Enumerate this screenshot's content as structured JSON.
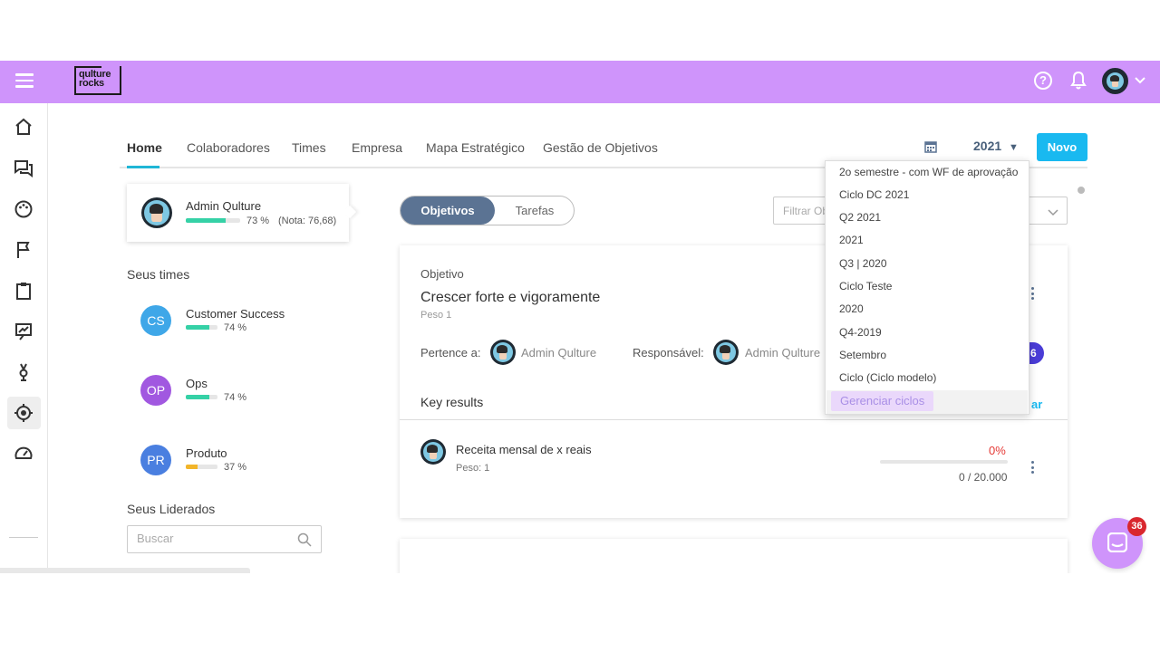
{
  "header": {
    "logo_line1": "qulture",
    "logo_line2": "rocks",
    "help_symbol": "?"
  },
  "sidebar": {
    "icons": [
      "home-icon",
      "chat-icon",
      "palette-icon",
      "flag-icon",
      "clipboard-icon",
      "presentation-icon",
      "award-icon",
      "target-icon",
      "speedometer-icon",
      "building-icon"
    ],
    "active": "target-icon"
  },
  "nav": {
    "tabs": [
      {
        "label": "Home"
      },
      {
        "label": "Colaboradores"
      },
      {
        "label": "Times"
      },
      {
        "label": "Empresa"
      },
      {
        "label": "Mapa Estratégico"
      },
      {
        "label": "Gestão de Objetivos"
      }
    ],
    "year": "2021",
    "year_arrow": "▼",
    "new_button": "Novo"
  },
  "user_card": {
    "name": "Admin Qulture",
    "progress_text": "73 %",
    "progress": 0.73,
    "score": "(Nota: 76,68)"
  },
  "teams": {
    "title": "Seus times",
    "items": [
      {
        "initials": "CS",
        "name": "Customer Success",
        "progress_text": "74 %",
        "progress": 0.74,
        "color": "#3fa7e8"
      },
      {
        "initials": "OP",
        "name": "Ops",
        "progress_text": "74 %",
        "progress": 0.74,
        "color": "#a158e0"
      },
      {
        "initials": "PR",
        "name": "Produto",
        "progress_text": "37 %",
        "progress": 0.37,
        "color": "#4a7fe0"
      }
    ]
  },
  "led": {
    "title": "Seus Liderados",
    "search_placeholder": "Buscar"
  },
  "toggle": {
    "active": "Objetivos",
    "inactive": "Tarefas"
  },
  "filter": {
    "placeholder": "Filtrar Ob"
  },
  "objective": {
    "label": "Objetivo",
    "title": "Crescer forte e vigoramente",
    "weight": "Peso 1",
    "belongs_label": "Pertence a:",
    "belongs_name": "Admin Qulture",
    "responsible_label": "Responsável:",
    "responsible_name": "Admin Qulture",
    "chip_text": "6",
    "kr_section": "Key results",
    "kr_link": "ar",
    "key_result": {
      "name": "Receita mensal de x reais",
      "weight": "Peso: 1",
      "percent": "0%",
      "progress": 0,
      "value": "0 / 20.000"
    }
  },
  "dropdown": {
    "items": [
      "2o semestre - com WF de aprovação",
      "Ciclo DC 2021",
      "Q2 2021",
      "2021",
      "Q3 | 2020",
      "Ciclo Teste",
      "2020",
      "Q4-2019",
      "Setembro",
      "Ciclo (Ciclo modelo)"
    ],
    "manage": "Gerenciar ciclos"
  },
  "chat": {
    "badge": "36"
  },
  "colors": {
    "topbar": "#cf94fb",
    "accent": "#19b9f0",
    "progress": "#35d1a6",
    "danger": "#e53935"
  }
}
